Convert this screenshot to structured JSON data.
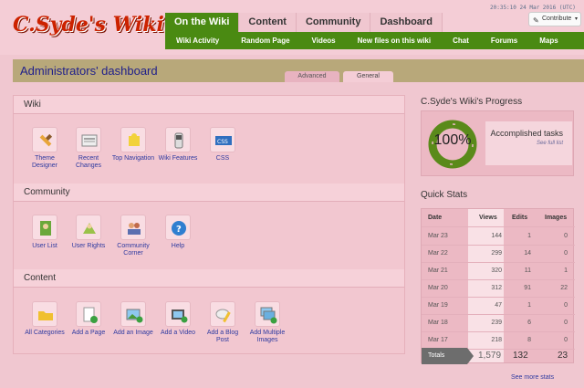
{
  "site": {
    "logo_text": "C.Syde's Wiki",
    "clock": "20:35:10 24 Mar 2016 (UTC)",
    "contribute_label": "Contribute"
  },
  "nav": {
    "tabs": [
      {
        "label": "On the Wiki",
        "active": true
      },
      {
        "label": "Content"
      },
      {
        "label": "Community"
      },
      {
        "label": "Dashboard"
      }
    ],
    "subnav": [
      "Wiki Activity",
      "Random Page",
      "Videos",
      "New files on this wiki",
      "Chat",
      "Forums",
      "Maps"
    ]
  },
  "page": {
    "title": "Administrators' dashboard",
    "subtabs": [
      "Advanced",
      "General"
    ],
    "active_subtab": "General"
  },
  "sections": [
    {
      "title": "Wiki",
      "tools": [
        {
          "label": "Theme Designer",
          "icon": "paintbrush-icon"
        },
        {
          "label": "Recent Changes",
          "icon": "newspaper-icon"
        },
        {
          "label": "Top Navigation",
          "icon": "puzzle-icon"
        },
        {
          "label": "Wiki Features",
          "icon": "toggle-icon"
        },
        {
          "label": "CSS",
          "icon": "css-icon"
        }
      ]
    },
    {
      "title": "Community",
      "tools": [
        {
          "label": "User List",
          "icon": "user-list-icon"
        },
        {
          "label": "User Rights",
          "icon": "user-rights-icon"
        },
        {
          "label": "Community Corner",
          "icon": "community-icon"
        },
        {
          "label": "Help",
          "icon": "help-icon"
        }
      ]
    },
    {
      "title": "Content",
      "tools": [
        {
          "label": "All Categories",
          "icon": "folder-icon"
        },
        {
          "label": "Add a Page",
          "icon": "add-page-icon"
        },
        {
          "label": "Add an Image",
          "icon": "add-image-icon"
        },
        {
          "label": "Add a Video",
          "icon": "add-video-icon"
        },
        {
          "label": "Add a Blog Post",
          "icon": "blog-post-icon"
        },
        {
          "label": "Add Multiple Images",
          "icon": "multiple-images-icon"
        }
      ]
    }
  ],
  "progress": {
    "title": "C.Syde's Wiki's Progress",
    "percent": "100%",
    "label": "Accomplished tasks",
    "link": "See full list"
  },
  "quick_stats": {
    "title": "Quick Stats",
    "headers": [
      "Date",
      "Views",
      "Edits",
      "Images"
    ],
    "rows": [
      [
        "Mar 23",
        "144",
        "1",
        "0"
      ],
      [
        "Mar 22",
        "299",
        "14",
        "0"
      ],
      [
        "Mar 21",
        "320",
        "11",
        "1"
      ],
      [
        "Mar 20",
        "312",
        "91",
        "22"
      ],
      [
        "Mar 19",
        "47",
        "1",
        "0"
      ],
      [
        "Mar 18",
        "239",
        "6",
        "0"
      ],
      [
        "Mar 17",
        "218",
        "8",
        "0"
      ]
    ],
    "totals_label": "Totals",
    "totals": [
      "1,579",
      "132",
      "23"
    ],
    "see_more": "See more stats"
  },
  "colors": {
    "nav_green": "#4a8a12",
    "header_bar": "#b8a87a",
    "link": "#2e3aa0",
    "logo": "#cc2200"
  }
}
